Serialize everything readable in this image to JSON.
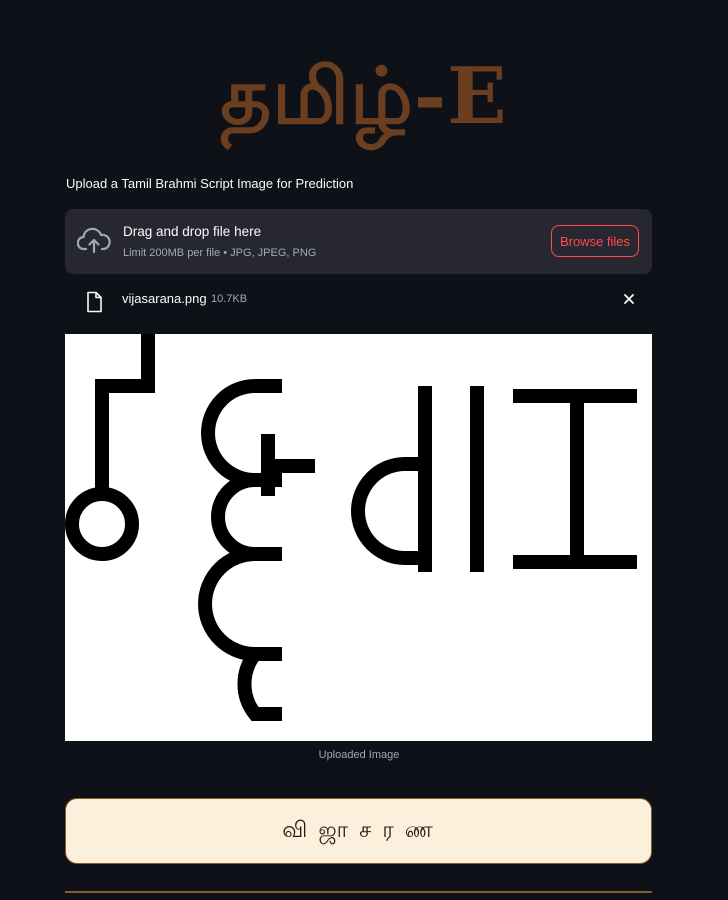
{
  "app": {
    "title": "தமிழ்-E"
  },
  "uploader": {
    "label": "Upload a Tamil Brahmi Script Image for Prediction",
    "dropzone_title": "Drag and drop file here",
    "dropzone_limit": "Limit 200MB per file • JPG, JPEG, PNG",
    "browse_label": "Browse files",
    "icon": "cloud-upload-icon"
  },
  "file": {
    "name": "vijasarana.png",
    "size": "10.7KB",
    "icon": "file-icon",
    "remove_icon": "close-icon"
  },
  "image": {
    "caption": "Uploaded Image"
  },
  "prediction": {
    "text": "வி ஜா ச ர ண"
  },
  "colors": {
    "background": "#0e1117",
    "title": "#6b3e1f",
    "dropzone_bg": "#262730",
    "accent": "#ff4b4b",
    "prediction_bg": "#faf0dc",
    "prediction_border": "#8b5a2b"
  }
}
